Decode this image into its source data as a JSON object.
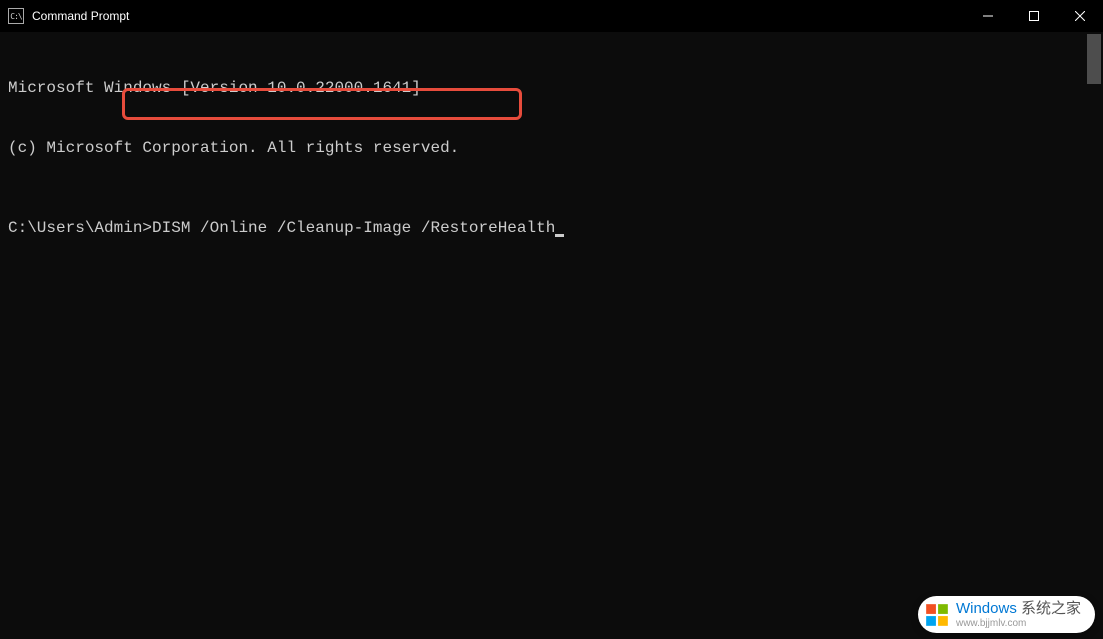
{
  "window": {
    "title": "Command Prompt",
    "icon_label": "C:\\"
  },
  "terminal": {
    "line1": "Microsoft Windows [Version 10.0.22000.1641]",
    "line2": "(c) Microsoft Corporation. All rights reserved.",
    "prompt": "C:\\Users\\Admin>",
    "command": "DISM /Online /Cleanup-Image /RestoreHealth"
  },
  "highlight": {
    "color": "#e74c3c"
  },
  "watermark": {
    "brand": "Windows",
    "brand_cn": " 系统之家",
    "url": "www.bjjmlv.com"
  }
}
